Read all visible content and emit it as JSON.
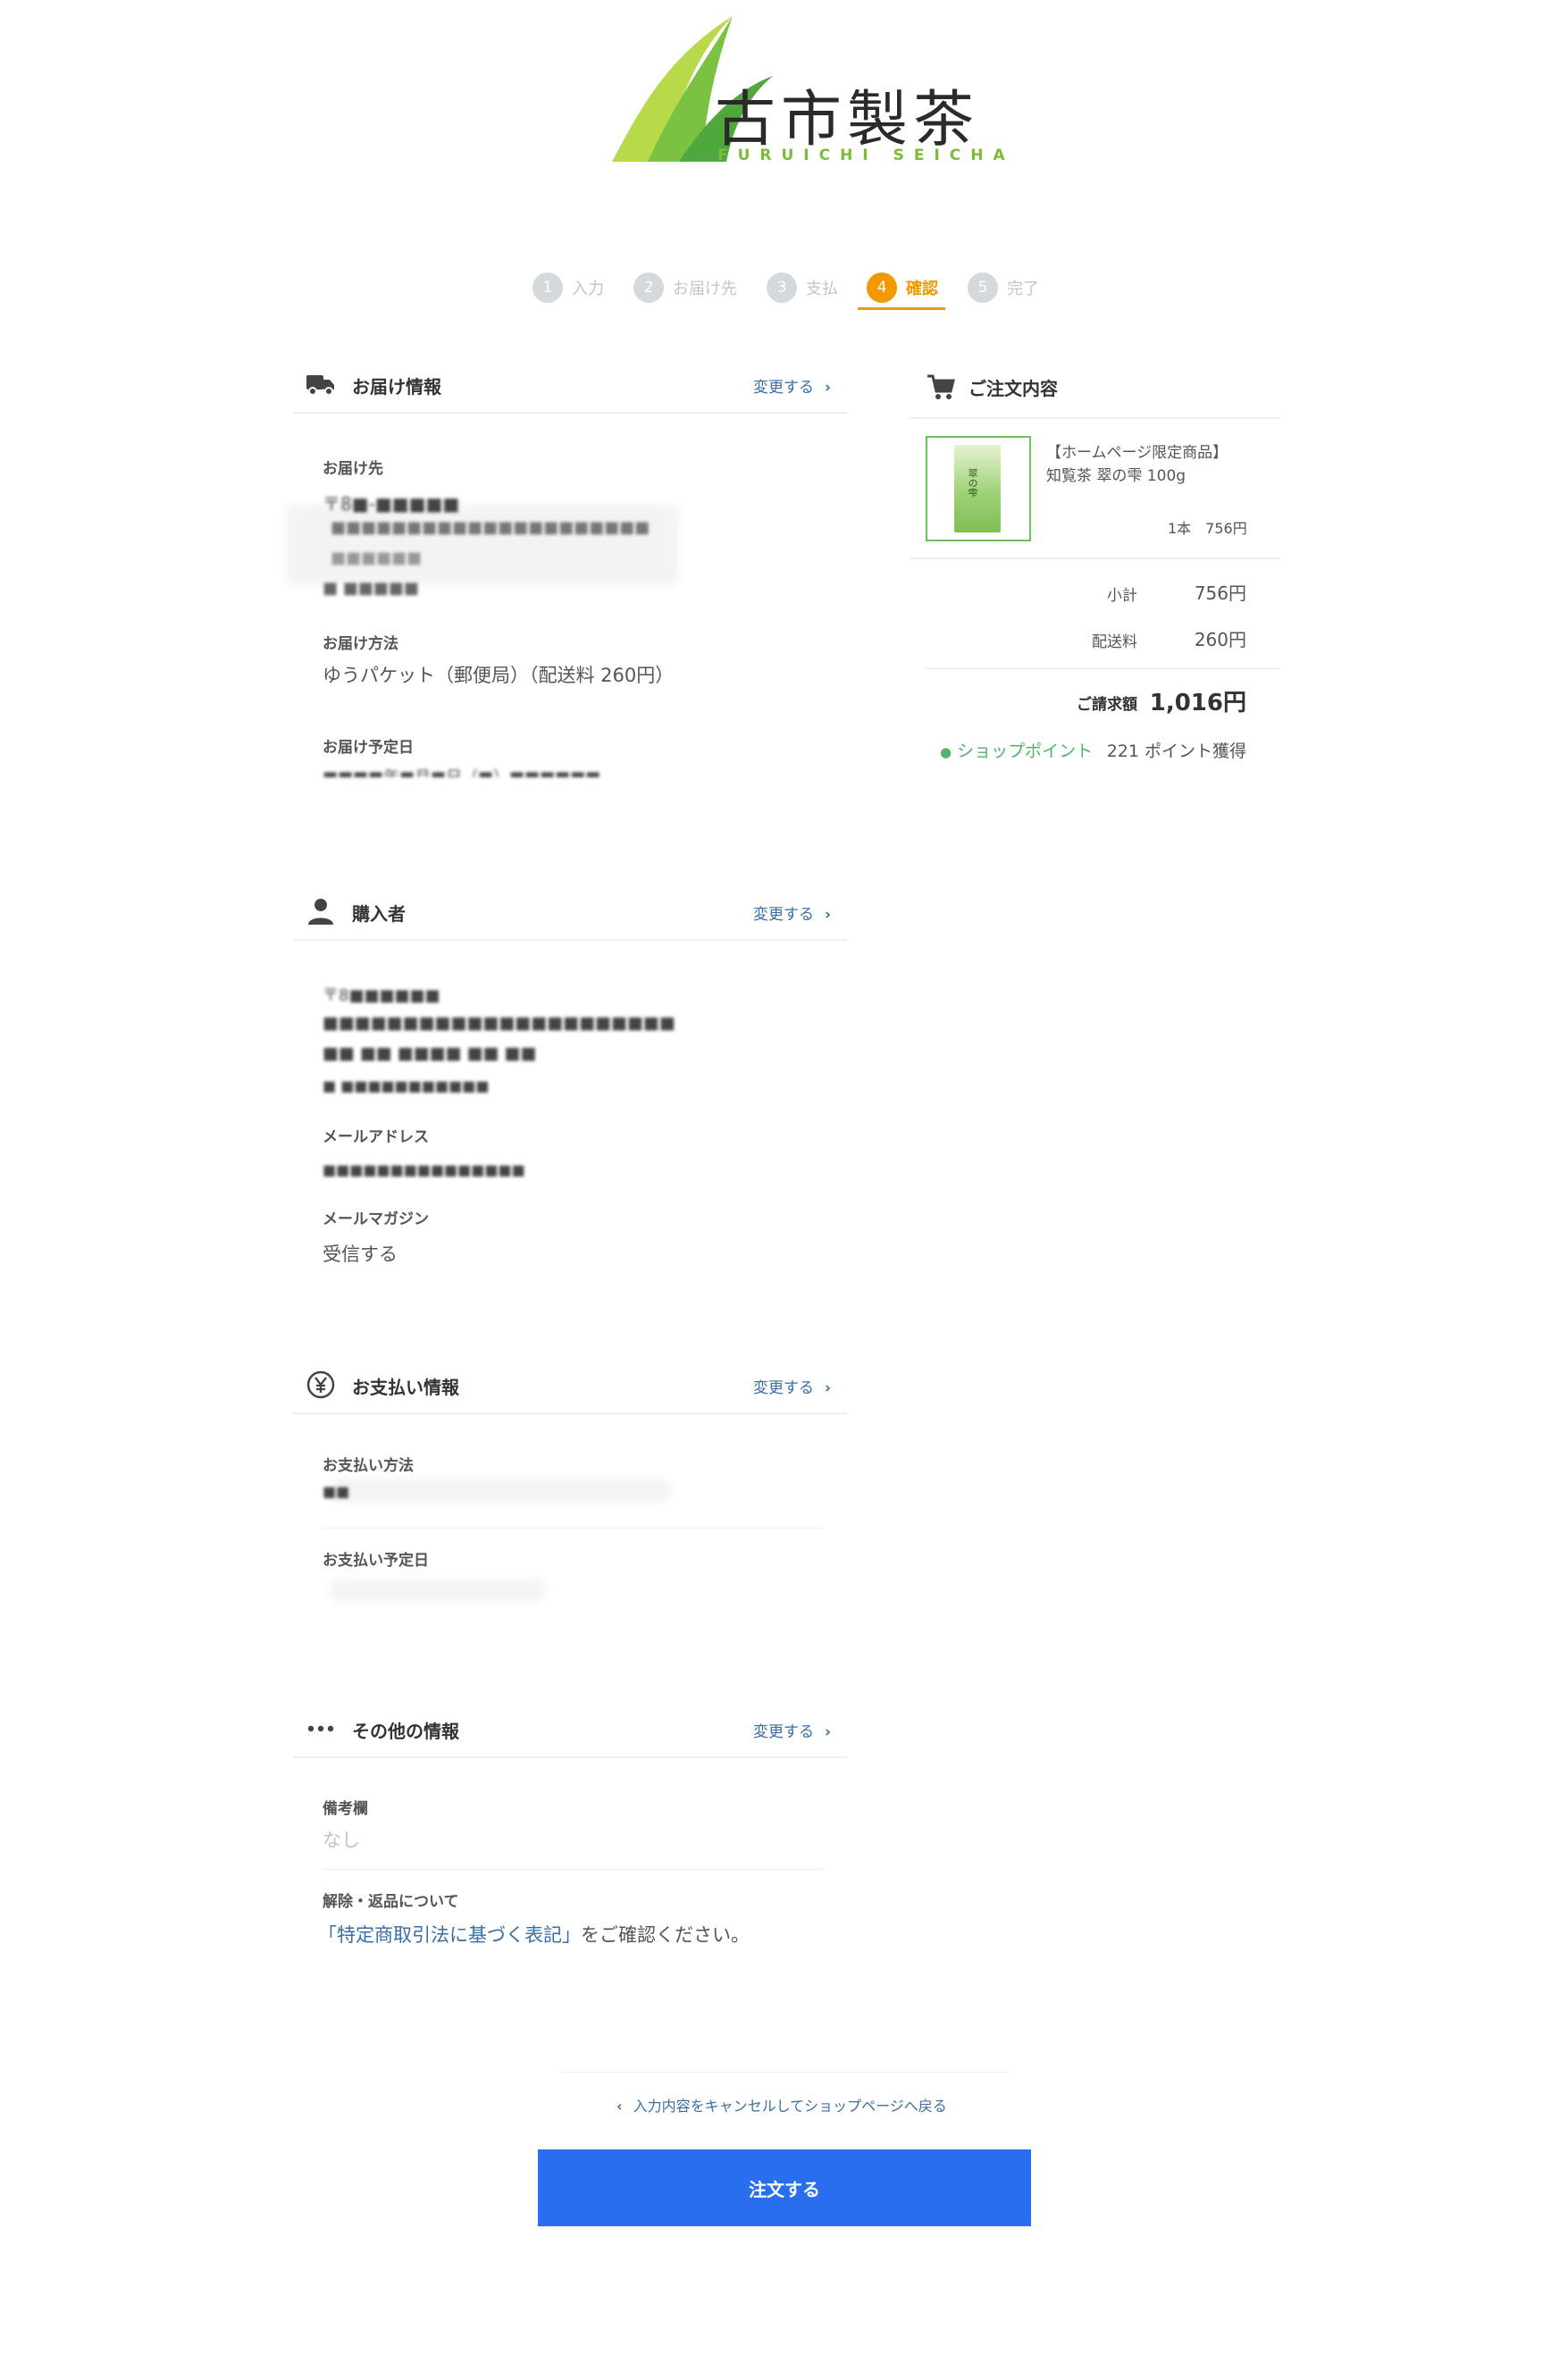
{
  "brand": {
    "name_kanji": "古市製茶",
    "name_roman": "FURUICHI SEICHA"
  },
  "steps": [
    {
      "num": "1",
      "label": "入力"
    },
    {
      "num": "2",
      "label": "お届け先"
    },
    {
      "num": "3",
      "label": "支払"
    },
    {
      "num": "4",
      "label": "確認",
      "active": true
    },
    {
      "num": "5",
      "label": "完了"
    }
  ],
  "change_label": "変更する",
  "delivery": {
    "title": "お届け情報",
    "destination_label": "お届け先",
    "destination_lines": [
      "〒8■-■■■■■",
      "■■■■■■■■■■■■■■■■■■■■■",
      "■■■■■■",
      "■ ■■■■■"
    ],
    "method_label": "お届け方法",
    "method_value": "ゆうパケット（郵便局）（配送料 260円）",
    "date_label": "お届け予定日",
    "date_value": "■■■■年■月■日（■）■■■■■■"
  },
  "buyer": {
    "title": "購入者",
    "address_lines": [
      "〒8■■■■■■",
      "■■■■■■■■■■■■■■■■■■■■■■",
      "■■ ■■ ■■■■ ■■ ■■",
      "■ ■■■■■■■■■■■"
    ],
    "email_label": "メールアドレス",
    "email_value": "■■■■■■■■■■■■■■■",
    "newsletter_label": "メールマガジン",
    "newsletter_value": "受信する"
  },
  "payment": {
    "title": "お支払い情報",
    "method_label": "お支払い方法",
    "method_value": "■■",
    "date_label": "お支払い予定日"
  },
  "other": {
    "title": "その他の情報",
    "remarks_label": "備考欄",
    "remarks_value": "なし",
    "cancel_label": "解除・返品について",
    "law_link": "「特定商取引法に基づく表記」",
    "law_suffix": "をご確認ください。"
  },
  "order": {
    "title": "ご注文内容",
    "product_line1": "【ホームページ限定商品】",
    "product_line2": "知覧茶 翠の雫 100g",
    "product_pack_text": "翠の雫",
    "quantity_price": "1本　756円",
    "subtotal_label": "小計",
    "subtotal_value": "756円",
    "shipping_label": "配送料",
    "shipping_value": "260円",
    "total_label": "ご請求額",
    "total_value": "1,016円",
    "points_label": "ショップポイント",
    "points_value": "221 ポイント獲得"
  },
  "back_link": "入力内容をキャンセルしてショップページへ戻る",
  "submit_label": "注文する",
  "colors": {
    "accent_orange": "#f39800",
    "primary_blue": "#2a6ef0",
    "link_blue": "#3a6ea5",
    "point_green": "#52b36b",
    "logo_green": "#7dbb3a"
  }
}
